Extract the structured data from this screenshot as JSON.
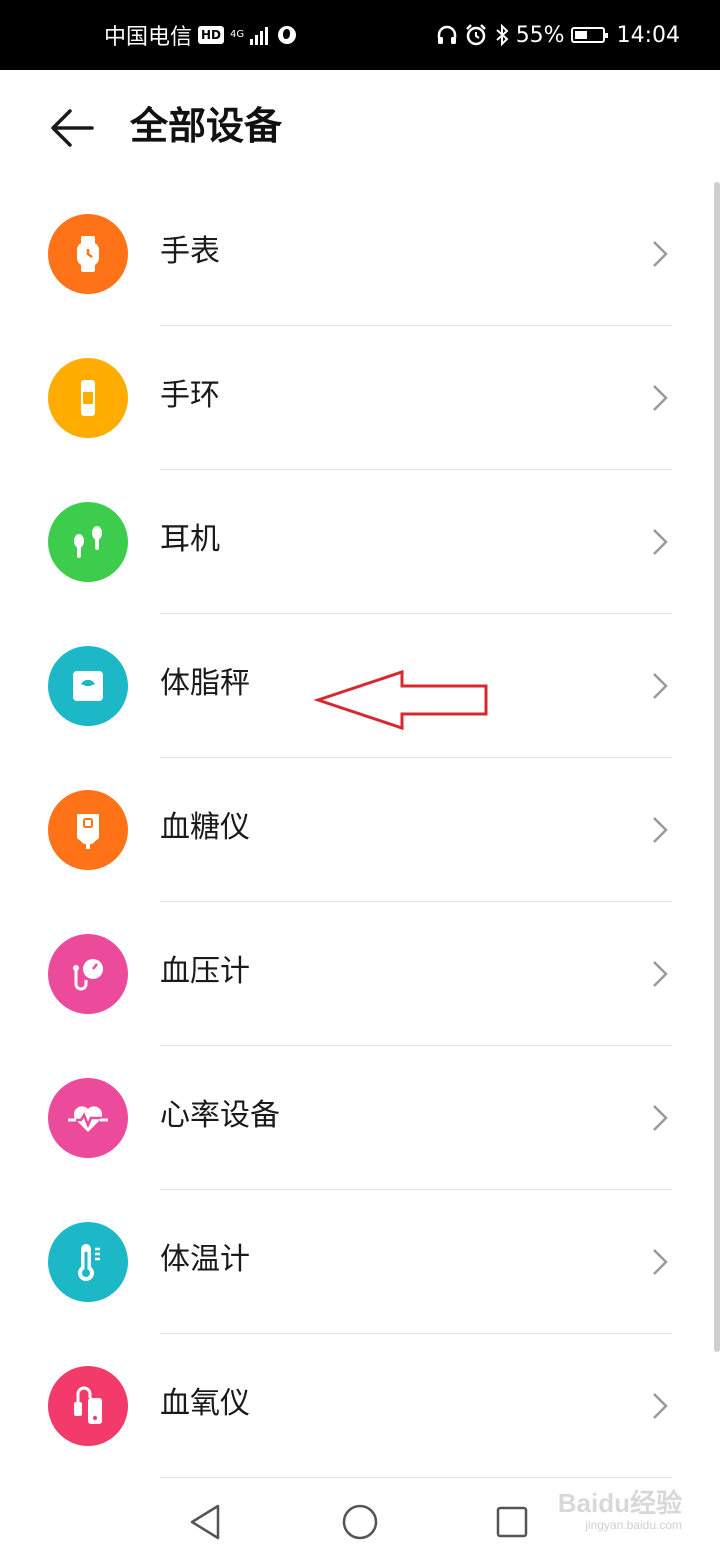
{
  "status_bar": {
    "carrier": "中国电信",
    "hd_badge": "HD",
    "network": "4G",
    "battery": "55%",
    "time": "14:04"
  },
  "header": {
    "title": "全部设备"
  },
  "devices": [
    {
      "label": "手表",
      "icon": "watch-icon",
      "color": "#FF7318"
    },
    {
      "label": "手环",
      "icon": "band-icon",
      "color": "#FFAC00"
    },
    {
      "label": "耳机",
      "icon": "earphones-icon",
      "color": "#3DCC4C"
    },
    {
      "label": "体脂秤",
      "icon": "scale-icon",
      "color": "#1DB8C8"
    },
    {
      "label": "血糖仪",
      "icon": "glucose-meter-icon",
      "color": "#FF7318"
    },
    {
      "label": "血压计",
      "icon": "blood-pressure-icon",
      "color": "#EC4A9A"
    },
    {
      "label": "心率设备",
      "icon": "heart-rate-icon",
      "color": "#EC4A9A"
    },
    {
      "label": "体温计",
      "icon": "thermometer-icon",
      "color": "#1DB8C8"
    },
    {
      "label": "血氧仪",
      "icon": "oximeter-icon",
      "color": "#F23A6B"
    }
  ],
  "annotation": {
    "color": "#D9272E",
    "target": "体脂秤"
  },
  "watermark": {
    "text": "Baidu经验",
    "sub": "jingyan.baidu.com"
  }
}
